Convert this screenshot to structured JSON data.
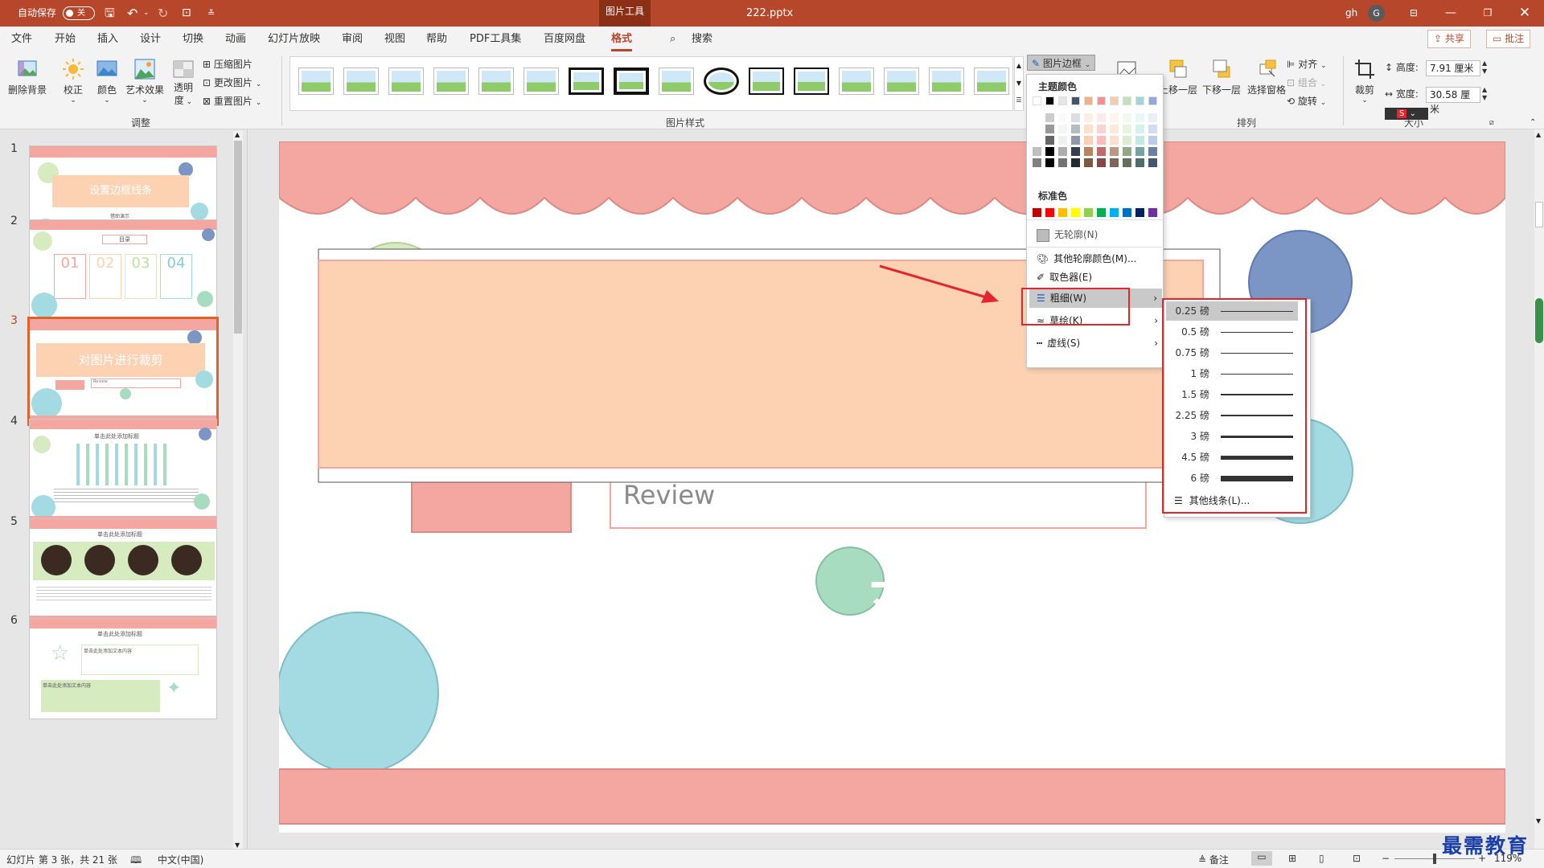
{
  "titlebar": {
    "autosave_label": "自动保存",
    "autosave_state": "关",
    "context_tab": "图片工具",
    "filename": "222.pptx",
    "user_name": "gh",
    "user_initial": "G"
  },
  "menu": {
    "tabs": [
      "文件",
      "开始",
      "插入",
      "设计",
      "切换",
      "动画",
      "幻灯片放映",
      "审阅",
      "视图",
      "帮助",
      "PDF工具集",
      "百度网盘",
      "格式"
    ],
    "active_tab": "格式",
    "search_label": "搜索",
    "share_label": "共享",
    "comment_label": "批注"
  },
  "ribbon": {
    "adjust": {
      "remove_bg": "删除背景",
      "correct": "校正",
      "color": "颜色",
      "art_effect": "艺术效果",
      "transparency_1": "透明",
      "transparency_2": "度",
      "compress": "压缩图片",
      "change": "更改图片",
      "reset": "重置图片",
      "group_label": "调整"
    },
    "styles": {
      "group_label": "图片样式",
      "border_label": "图片边框"
    },
    "arrange": {
      "bring_forward": "上移一层",
      "send_backward": "下移一层",
      "selection_pane": "选择窗格",
      "align": "对齐",
      "group": "组合",
      "rotate": "旋转",
      "group_label": "排列"
    },
    "size": {
      "crop": "裁剪",
      "height_label": "高度:",
      "height_value": "7.91 厘米",
      "width_label": "宽度:",
      "width_value": "30.58 厘米",
      "group_label": "大小"
    }
  },
  "thumbnails": {
    "slides": [
      {
        "num": "1",
        "title": "设置边框线条",
        "sub": "借助演示"
      },
      {
        "num": "2",
        "title": "目录",
        "items": [
          "01",
          "02",
          "03",
          "04"
        ]
      },
      {
        "num": "3",
        "title": "对图片进行裁剪",
        "sub": "Review"
      },
      {
        "num": "4",
        "title": "单击此处添加标题"
      },
      {
        "num": "5",
        "title": "单击此处添加标题"
      },
      {
        "num": "6",
        "title": "单击此处添加标题",
        "sub": "单击此处添加文本内容",
        "sub2": "单击此处添加文本内容"
      }
    ],
    "selected": "3"
  },
  "slide": {
    "title": "对图片进行裁剪",
    "review": "Review"
  },
  "border_menu": {
    "theme_colors_label": "主题颜色",
    "standard_colors_label": "标准色",
    "no_outline": "无轮廓(N)",
    "more_colors": "其他轮廓颜色(M)...",
    "eyedropper": "取色器(E)",
    "weight": "粗细(W)",
    "sketch": "草绘(K)",
    "dashes": "虚线(S)",
    "theme_top_row": [
      "#ffffff",
      "#000000",
      "#e7e6e6",
      "#44546a",
      "#f4b183",
      "#ff8f8f",
      "#f8cbad",
      "#c5e0b4",
      "#9dd8d8",
      "#8faadc"
    ],
    "standard_colors": [
      "#c00000",
      "#ff0000",
      "#ffc000",
      "#ffff00",
      "#92d050",
      "#00b050",
      "#00b0f0",
      "#0070c0",
      "#002060",
      "#7030a0"
    ]
  },
  "weight_menu": {
    "items": [
      {
        "label": "0.25 磅",
        "thickness": 0.25
      },
      {
        "label": "0.5 磅",
        "thickness": 0.5
      },
      {
        "label": "0.75 磅",
        "thickness": 0.75
      },
      {
        "label": "1 磅",
        "thickness": 1
      },
      {
        "label": "1.5 磅",
        "thickness": 1.5
      },
      {
        "label": "2.25 磅",
        "thickness": 2.25
      },
      {
        "label": "3 磅",
        "thickness": 3
      },
      {
        "label": "4.5 磅",
        "thickness": 4.5
      },
      {
        "label": "6 磅",
        "thickness": 6
      }
    ],
    "more_lines": "其他线条(L)..."
  },
  "statusbar": {
    "slide_info": "幻灯片 第 3 张，共 21 张",
    "language": "中文(中国)",
    "notes": "备注",
    "zoom": "119%"
  },
  "watermark": "最需教育",
  "colors": {
    "accent": "#b7472a",
    "salmon": "#f4a6a0",
    "peach": "#fcd2b3",
    "teal": "#a4dbe3",
    "green": "#a8dcc1",
    "blue": "#7b96c4",
    "highlight_red": "#e3262d"
  }
}
